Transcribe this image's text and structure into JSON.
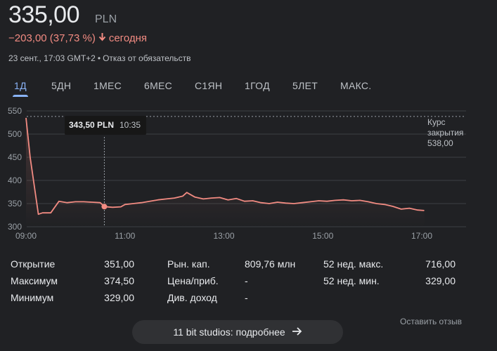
{
  "header": {
    "price": "335,00",
    "currency": "PLN",
    "change": "−203,00 (37,73 %)",
    "change_period": "сегодня",
    "timestamp": "23 сент., 17:03 GMT+2",
    "separator": "•",
    "disclaimer": "Отказ от обязательств",
    "negative_color": "#f28b82"
  },
  "tabs": [
    {
      "label": "1Д",
      "active": true
    },
    {
      "label": "5ДН"
    },
    {
      "label": "1МЕС"
    },
    {
      "label": "6МЕС"
    },
    {
      "label": "С1ЯН"
    },
    {
      "label": "1ГОД"
    },
    {
      "label": "5ЛЕТ"
    },
    {
      "label": "МАКС."
    }
  ],
  "chart_data": {
    "type": "line",
    "ylim": [
      300,
      550
    ],
    "yticks": [
      "550",
      "500",
      "450",
      "400",
      "350",
      "300"
    ],
    "xticks": [
      "09:00",
      "11:00",
      "13:00",
      "15:00",
      "17:00"
    ],
    "line_color": "#f28b82",
    "grid": true,
    "previous_close": {
      "label_line1": "Курс",
      "label_line2": "закрытия",
      "value": "538,00"
    },
    "tooltip": {
      "price": "343,50 PLN",
      "time": "10:35"
    },
    "x": [
      "09:00",
      "09:05",
      "09:15",
      "09:20",
      "09:30",
      "09:40",
      "09:50",
      "10:00",
      "10:10",
      "10:20",
      "10:30",
      "10:35",
      "10:45",
      "10:55",
      "11:00",
      "11:10",
      "11:20",
      "11:30",
      "11:40",
      "11:50",
      "12:00",
      "12:10",
      "12:15",
      "12:25",
      "12:35",
      "12:45",
      "12:55",
      "13:05",
      "13:15",
      "13:25",
      "13:35",
      "13:45",
      "13:55",
      "14:05",
      "14:15",
      "14:25",
      "14:35",
      "14:45",
      "14:55",
      "15:05",
      "15:15",
      "15:25",
      "15:35",
      "15:45",
      "15:55",
      "16:05",
      "16:15",
      "16:25",
      "16:35",
      "16:45",
      "16:55",
      "17:03"
    ],
    "values": [
      535,
      450,
      327,
      330,
      330,
      355,
      352,
      354,
      354,
      353,
      352,
      343.5,
      342,
      343,
      348,
      350,
      352,
      355,
      358,
      360,
      362,
      366,
      374,
      364,
      360,
      362,
      363,
      358,
      361,
      355,
      356,
      352,
      350,
      353,
      351,
      350,
      352,
      354,
      356,
      355,
      357,
      358,
      356,
      357,
      354,
      350,
      348,
      344,
      338,
      340,
      336,
      335
    ]
  },
  "stats": {
    "col1": [
      {
        "label": "Открытие",
        "value": "351,00"
      },
      {
        "label": "Максимум",
        "value": "374,50"
      },
      {
        "label": "Минимум",
        "value": "329,00"
      }
    ],
    "col2": [
      {
        "label": "Рын. кап.",
        "value": "809,76 млн"
      },
      {
        "label": "Цена/приб.",
        "value": "-"
      },
      {
        "label": "Див. доход",
        "value": "-"
      }
    ],
    "col3": [
      {
        "label": "52 нед. макс.",
        "value": "716,00"
      },
      {
        "label": "52 нед. мин.",
        "value": "329,00"
      }
    ]
  },
  "footer": {
    "more_label": "11 bit studios: подробнее",
    "feedback_label": "Оставить отзыв"
  }
}
